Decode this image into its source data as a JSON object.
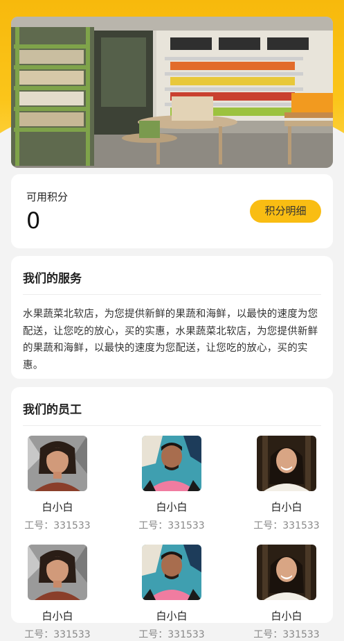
{
  "points": {
    "label": "可用积分",
    "value": "0",
    "detail_button": "积分明细"
  },
  "services": {
    "title": "我们的服务",
    "description": "水果蔬菜北软店，为您提供新鲜的果蔬和海鲜，以最快的速度为您配送，让您吃的放心，买的实惠，水果蔬菜北软店，为您提供新鲜的果蔬和海鲜，以最快的速度为您配送，让您吃的放心，买的实惠。"
  },
  "staff": {
    "title": "我们的员工",
    "members": [
      {
        "name": "白小白",
        "id_text": "工号：331533"
      },
      {
        "name": "白小白",
        "id_text": "工号：331533"
      },
      {
        "name": "白小白",
        "id_text": "工号：331533"
      },
      {
        "name": "白小白",
        "id_text": "工号：331533"
      },
      {
        "name": "白小白",
        "id_text": "工号：331533"
      },
      {
        "name": "白小白",
        "id_text": "工号：331533"
      }
    ]
  },
  "colors": {
    "accent": "#f9bd13",
    "header": "#f7b90c"
  }
}
